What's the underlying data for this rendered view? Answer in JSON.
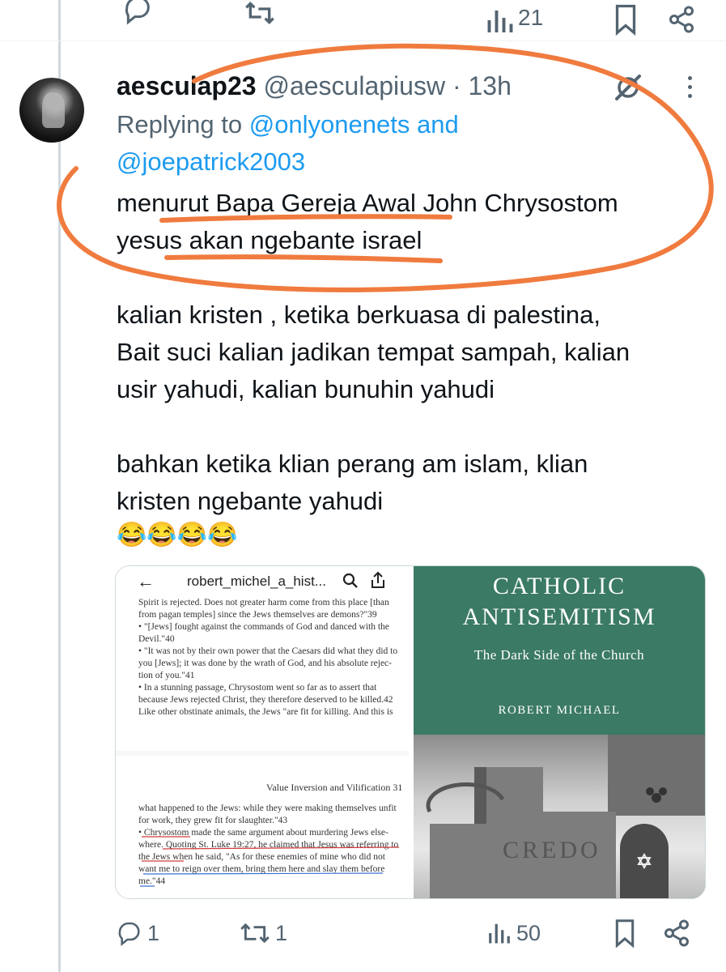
{
  "previous_tweet": {
    "actions": [
      "reply-icon",
      "retweet-icon",
      "views-icon",
      "bookmark-icon",
      "share-icon"
    ],
    "views_count_partial": "21"
  },
  "tweet": {
    "display_name": "aesculap23",
    "handle": "@aesculapiusw",
    "separator": "·",
    "time": "13h",
    "replying_prefix": "Replying to",
    "replying_to_1": "@onlyonenets",
    "replying_and": "and",
    "replying_to_2": "@joepatrick2003",
    "lines": [
      "menurut Bapa Gereja Awal John Chrysostom",
      "yesus akan ngebante israel",
      "",
      "kalian kristen , ketika berkuasa di palestina,",
      "Bait suci kalian jadikan tempat sampah, kalian",
      "usir yahudi, kalian bunuhin yahudi",
      "",
      "bahkan ketika klian perang am islam, klian",
      "kristen ngebante yahudi",
      "😂😂😂😂"
    ],
    "annotation_color": "#f07b3f"
  },
  "media": {
    "left": {
      "viewer_filename": "robert_michel_a_hist...",
      "top_lines": [
        "Spirit is rejected. Does not greater harm come from this place [than",
        "from pagan temples] since the Jews themselves are demons?\"39",
        "•  \"[Jews] fought against the commands of God and danced with the",
        "   Devil.\"40",
        "•  \"It was not by their own power that the Caesars did what they did to",
        "   you [Jews]; it was done by the wrath of God, and his absolute rejec-",
        "   tion of you.\"41",
        "•  In a stunning passage, Chrysostom went so far as to assert that",
        "   because Jews rejected Christ, they therefore deserved to be killed.42",
        "   Like other obstinate animals, the Jews \"are fit for killing. And this is"
      ],
      "page_header": "Value Inversion and Vilification  31",
      "bottom_lines": [
        "what happened to the Jews: while they were making themselves unfit",
        "for work, they grew fit for slaughter.\"43",
        "•  Chrysostom made the same argument about murdering Jews else-",
        "   where. Quoting St. Luke 19:27, he claimed that Jesus was referring to",
        "   the Jews when he said, \"As for these enemies of mine who did not",
        "   want me to reign over them, bring them here and slay them before",
        "   me.\"44"
      ]
    },
    "right": {
      "title_line1": "CATHOLIC",
      "title_line2": "ANTISEMITISM",
      "subtitle": "The Dark Side of the Church",
      "author": "ROBERT MICHAEL",
      "photo_inscription": "CREDO",
      "cover_color": "#3b7a64"
    }
  },
  "actions": {
    "reply_count": "1",
    "retweet_count": "1",
    "views_count": "50"
  }
}
